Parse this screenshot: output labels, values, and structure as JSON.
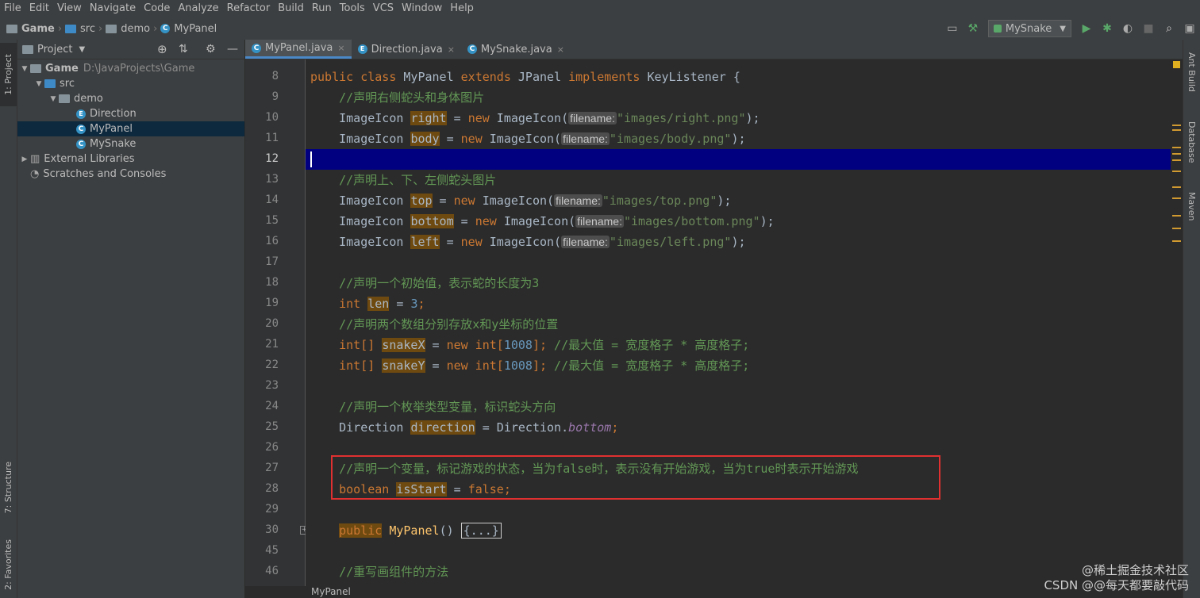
{
  "menu": [
    "File",
    "Edit",
    "View",
    "Navigate",
    "Code",
    "Analyze",
    "Refactor",
    "Build",
    "Run",
    "Tools",
    "VCS",
    "Window",
    "Help"
  ],
  "breadcrumb": {
    "project": "Game",
    "folder1": "src",
    "folder2": "demo",
    "file": "MyPanel"
  },
  "toolbar": {
    "run_config": "MySnake"
  },
  "left_strip": {
    "project_tab": "1: Project",
    "structure_tab": "7: Structure",
    "favorites_tab": "2: Favorites"
  },
  "right_strip": {
    "ant": "Ant Build",
    "database": "Database",
    "maven": "Maven"
  },
  "project_panel": {
    "title": "Project",
    "root_name": "Game",
    "root_path": "D:\\JavaProjects\\Game",
    "src": "src",
    "demo": "demo",
    "files": [
      "Direction",
      "MyPanel",
      "MySnake"
    ],
    "external": "External Libraries",
    "scratches": "Scratches and Consoles"
  },
  "tabs": [
    "MyPanel.java",
    "Direction.java",
    "MySnake.java"
  ],
  "line_numbers": [
    "8",
    "9",
    "10",
    "11",
    "12",
    "13",
    "14",
    "15",
    "16",
    "17",
    "18",
    "19",
    "20",
    "21",
    "22",
    "23",
    "24",
    "25",
    "26",
    "27",
    "28",
    "29",
    "30",
    "45",
    "46"
  ],
  "code": {
    "l8": {
      "p1": "public",
      "p2": "class",
      "p3": "MyPanel",
      "p4": "extends",
      "p5": "JPanel",
      "p6": "implements",
      "p7": "KeyListener {"
    },
    "l9": "//声明右侧蛇头和身体图片",
    "l10": {
      "type": "ImageIcon",
      "var": "right",
      "eq": " = ",
      "new": "new",
      "cls": " ImageIcon(",
      "hint": "filename:",
      "str": "\"images/right.png\"",
      "end": ");"
    },
    "l11": {
      "type": "ImageIcon",
      "var": "body",
      "eq": " = ",
      "new": "new",
      "cls": " ImageIcon(",
      "hint": "filename:",
      "str": "\"images/body.png\"",
      "end": ");"
    },
    "l13": "//声明上、下、左侧蛇头图片",
    "l14": {
      "type": "ImageIcon",
      "var": "top",
      "eq": " = ",
      "new": "new",
      "cls": " ImageIcon(",
      "hint": "filename:",
      "str": "\"images/top.png\"",
      "end": ");"
    },
    "l15": {
      "type": "ImageIcon",
      "var": "bottom",
      "eq": " = ",
      "new": "new",
      "cls": " ImageIcon(",
      "hint": "filename:",
      "str": "\"images/bottom.png\"",
      "end": ");"
    },
    "l16": {
      "type": "ImageIcon",
      "var": "left",
      "eq": " = ",
      "new": "new",
      "cls": " ImageIcon(",
      "hint": "filename:",
      "str": "\"images/left.png\"",
      "end": ");"
    },
    "l18": "//声明一个初始值，表示蛇的长度为3",
    "l19": {
      "type": "int",
      "var": "len",
      "eq": " = ",
      "num": "3",
      "end": ";"
    },
    "l20": "//声明两个数组分别存放x和y坐标的位置",
    "l21": {
      "type": "int[]",
      "var": "snakeX",
      "eq": " = ",
      "new": "new",
      "t2": " int[",
      "num": "1008",
      "end": "];",
      "cm": " //最大值 = 宽度格子 * 高度格子;"
    },
    "l22": {
      "type": "int[]",
      "var": "snakeY",
      "eq": " = ",
      "new": "new",
      "t2": " int[",
      "num": "1008",
      "end": "];",
      "cm": " //最大值 = 宽度格子 * 高度格子;"
    },
    "l24": "//声明一个枚举类型变量，标识蛇头方向",
    "l25": {
      "type": "Direction",
      "var": "direction",
      "eq": " = Direction.",
      "field": "bottom",
      "end": ";"
    },
    "l27": "//声明一个变量，标记游戏的状态，当为false时，表示没有开始游戏，当为true时表示开始游戏",
    "l28": {
      "type": "boolean",
      "var": "isStart",
      "eq": " = ",
      "val": "false",
      "end": ";"
    },
    "l30": {
      "kw": "public",
      "name": "MyPanel",
      "paren": "() ",
      "fold": "{...}"
    },
    "l46": "//重写画组件的方法"
  },
  "status_bar": {
    "file": "MyPanel"
  },
  "watermark": {
    "line1": "@稀土掘金技术社区",
    "line2": "CSDN @@每天都要敲代码"
  },
  "colors": {
    "keyword": "#cc7832",
    "comment": "#629755",
    "string": "#6a8759",
    "number": "#6897bb",
    "highlight": "#6f4a10",
    "current_line": "#000080",
    "red_box": "#e03030"
  }
}
